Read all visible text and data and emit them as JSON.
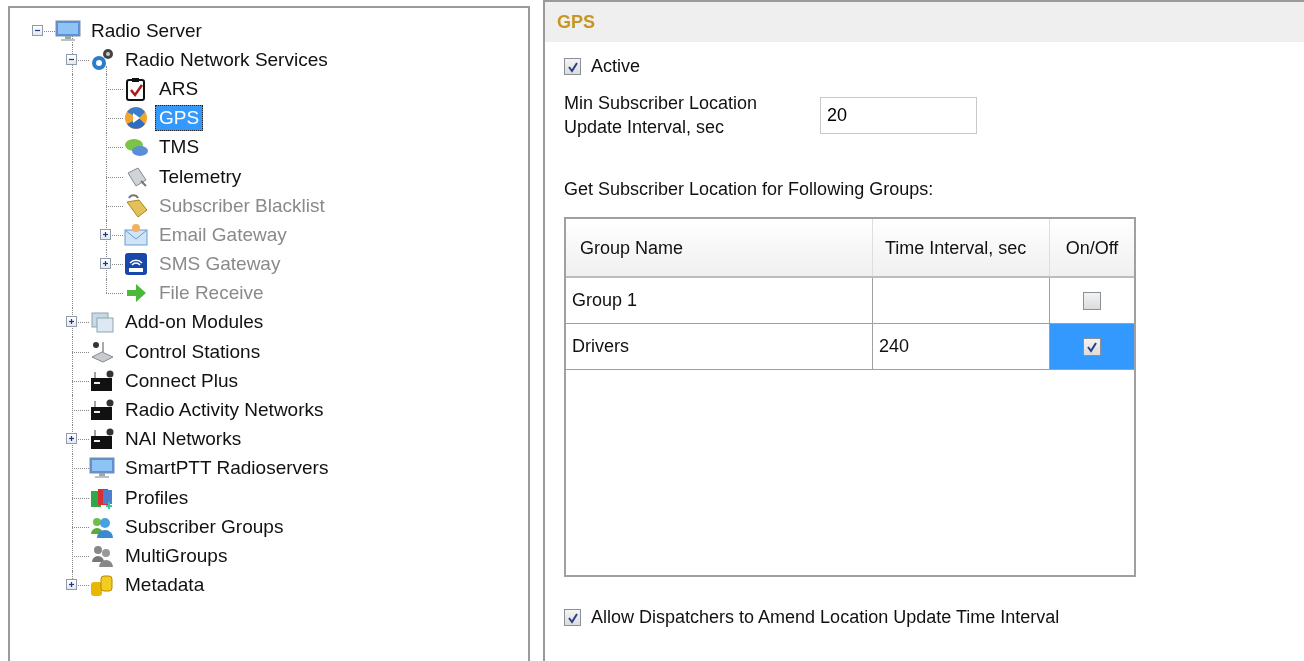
{
  "tree": [
    {
      "label": "Radio Server",
      "kind": "monitor",
      "expanded": true,
      "disabled": false,
      "selected": false,
      "children": [
        {
          "label": "Radio Network Services",
          "kind": "gears",
          "expanded": true,
          "disabled": false,
          "selected": false,
          "children": [
            {
              "label": "ARS",
              "kind": "clipboard",
              "disabled": false,
              "selected": false
            },
            {
              "label": "GPS",
              "kind": "globe",
              "disabled": false,
              "selected": true
            },
            {
              "label": "TMS",
              "kind": "chat",
              "disabled": false,
              "selected": false
            },
            {
              "label": "Telemetry",
              "kind": "plug",
              "disabled": false,
              "selected": false
            },
            {
              "label": "Subscriber Blacklist",
              "kind": "lock",
              "disabled": true,
              "selected": false
            },
            {
              "label": "Email Gateway",
              "kind": "envelope",
              "expanded": false,
              "disabled": true,
              "selected": false
            },
            {
              "label": "SMS Gateway",
              "kind": "sms",
              "expanded": false,
              "disabled": true,
              "selected": false
            },
            {
              "label": "File Receive",
              "kind": "arrow",
              "disabled": true,
              "selected": false
            }
          ]
        },
        {
          "label": "Add-on Modules",
          "kind": "windows",
          "expanded": false,
          "disabled": false,
          "selected": false
        },
        {
          "label": "Control Stations",
          "kind": "station",
          "disabled": false,
          "selected": false
        },
        {
          "label": "Connect Plus",
          "kind": "radio",
          "disabled": false,
          "selected": false
        },
        {
          "label": "Radio Activity Networks",
          "kind": "radio",
          "disabled": false,
          "selected": false
        },
        {
          "label": "NAI Networks",
          "kind": "radio",
          "expanded": false,
          "disabled": false,
          "selected": false
        },
        {
          "label": "SmartPTT Radioservers",
          "kind": "monitor",
          "disabled": false,
          "selected": false
        },
        {
          "label": "Profiles",
          "kind": "cards",
          "disabled": false,
          "selected": false
        },
        {
          "label": "Subscriber Groups",
          "kind": "people",
          "disabled": false,
          "selected": false
        },
        {
          "label": "MultiGroups",
          "kind": "users",
          "disabled": false,
          "selected": false
        },
        {
          "label": "Metadata",
          "kind": "cylinders",
          "expanded": false,
          "disabled": false,
          "selected": false
        }
      ]
    }
  ],
  "panel": {
    "title": "GPS",
    "active": {
      "label": "Active",
      "checked": true
    },
    "interval": {
      "label": "Min Subscriber Location Update Interval, sec",
      "value": "20"
    },
    "groups_label": "Get Subscriber Location for Following Groups:",
    "table": {
      "columns": [
        "Group Name",
        "Time Interval, sec",
        "On/Off"
      ],
      "rows": [
        {
          "name": "Group 1",
          "interval": "",
          "on": false,
          "selected": false
        },
        {
          "name": "Drivers",
          "interval": "240",
          "on": true,
          "selected": true
        }
      ]
    },
    "allow": {
      "label": "Allow Dispatchers to Amend Location Update Time Interval",
      "checked": true
    }
  }
}
